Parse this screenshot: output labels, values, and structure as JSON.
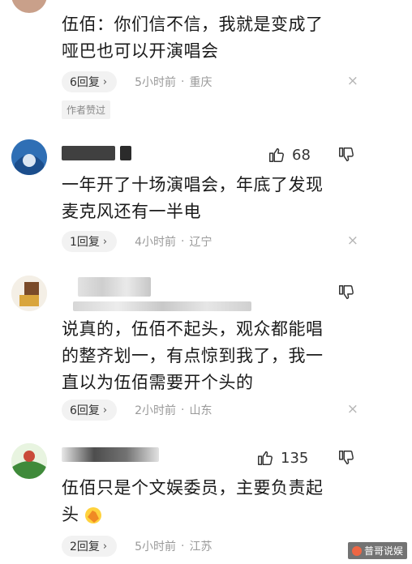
{
  "comments": [
    {
      "text_line1": "伍佰：你们信不信，我就是变成了",
      "text_line2": "哑巴也可以开演唱会",
      "replies": "6回复",
      "time": "5小时前",
      "location": "重庆",
      "badge": "作者赞过"
    },
    {
      "likes": "68",
      "text_line1": "一年开了十场演唱会，年底了发现",
      "text_line2": "麦克风还有一半电",
      "replies": "1回复",
      "time": "4小时前",
      "location": "辽宁"
    },
    {
      "text_line1": "说真的，伍佰不起头，观众都能唱",
      "text_line2": "的整齐划一，有点惊到我了，我一",
      "text_line3": "直以为伍佰需要开个头的",
      "replies": "6回复",
      "time": "2小时前",
      "location": "山东"
    },
    {
      "likes": "135",
      "text_line1": "伍佰只是个文娱委员，主要负责起",
      "text_line2": "头",
      "replies": "2回复",
      "time": "5小时前",
      "location": "江苏"
    }
  ],
  "icons": {
    "reply_chevron": "›",
    "close": "×",
    "dot": "·"
  },
  "watermark": "普哥说娱",
  "colors": {
    "meta_text": "#9a9a9a",
    "pill_bg": "#f2f2f2",
    "text": "#1a1a1a"
  }
}
